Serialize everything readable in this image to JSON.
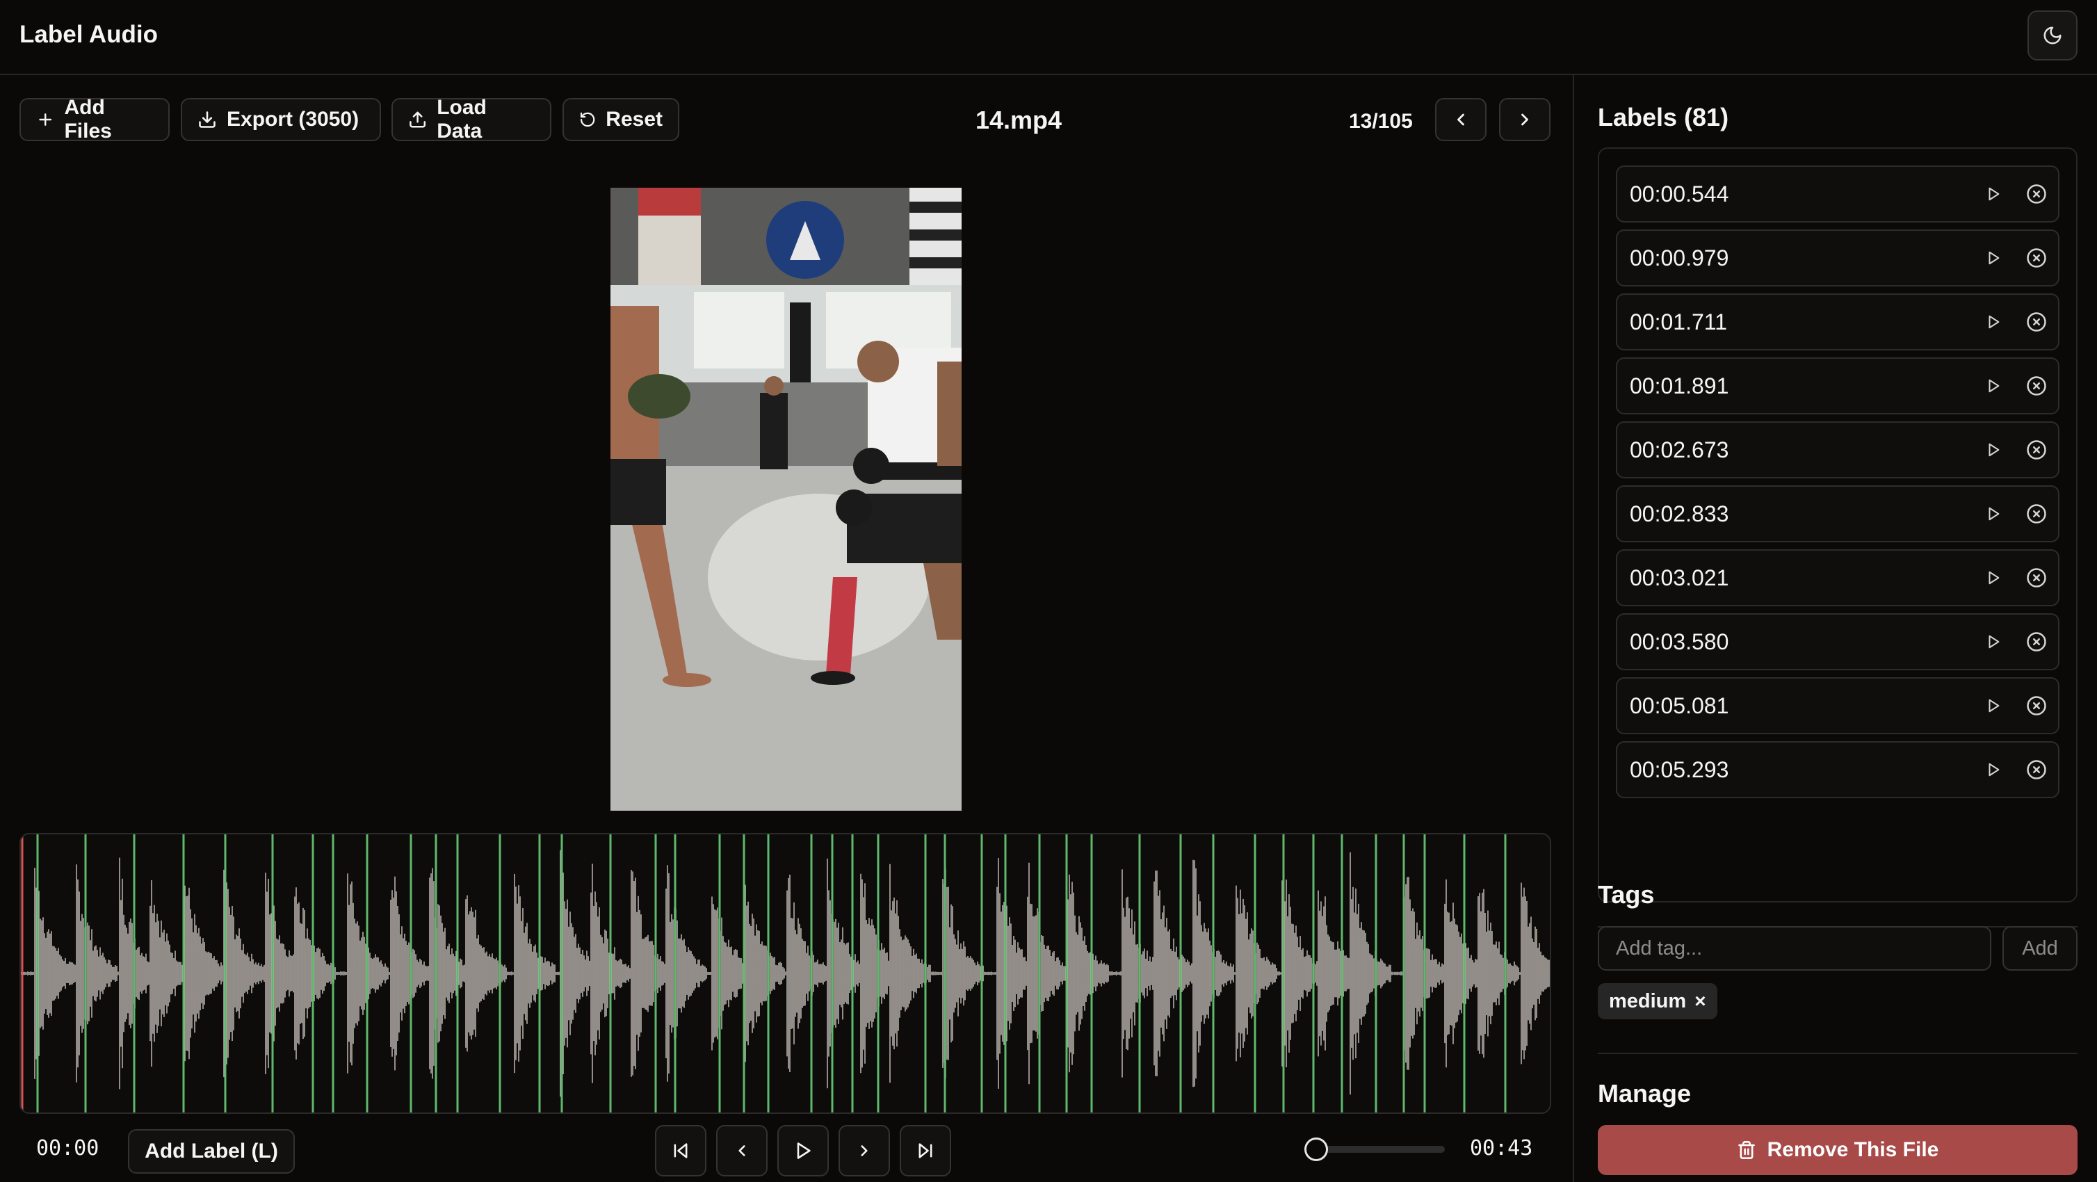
{
  "app": {
    "title": "Label Audio"
  },
  "toolbar": {
    "add_files": "Add Files",
    "export": "Export (3050)",
    "load_data": "Load Data",
    "reset": "Reset"
  },
  "file": {
    "name": "14.mp4",
    "counter": "13/105"
  },
  "playback": {
    "current_time": "00:00",
    "duration": "00:43",
    "add_label": "Add Label (L)",
    "volume": 0
  },
  "labels": {
    "heading": "Labels (81)",
    "items": [
      "00:00.544",
      "00:00.979",
      "00:01.711",
      "00:01.891",
      "00:02.673",
      "00:02.833",
      "00:03.021",
      "00:03.580",
      "00:05.081",
      "00:05.293"
    ]
  },
  "tags": {
    "heading": "Tags",
    "placeholder": "Add tag...",
    "add_label": "Add",
    "items": [
      "medium"
    ],
    "remove_glyph": "×"
  },
  "manage": {
    "heading": "Manage",
    "remove_file": "Remove This File"
  },
  "colors": {
    "background": "#0a0908",
    "label_marker": "#5fb86b",
    "waveform": "#b3aea8",
    "playhead": "#d9534f",
    "danger": "#a84a47"
  },
  "icons": {
    "theme": "moon-icon",
    "add": "plus-icon",
    "export": "download-icon",
    "load": "upload-icon",
    "reset": "rotate-ccw-icon",
    "prev": "chevron-left-icon",
    "next": "chevron-right-icon",
    "play": "play-icon",
    "remove_label": "circle-x-icon",
    "skip_start": "skip-back-icon",
    "skip_end": "skip-forward-icon",
    "trash": "trash-icon"
  }
}
